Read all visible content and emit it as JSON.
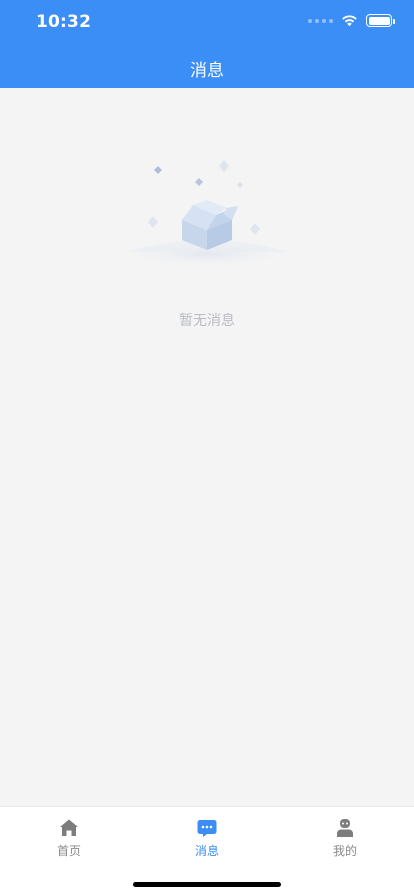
{
  "status_bar": {
    "time": "10:32",
    "icons": [
      "cellular-signal-icon",
      "wifi-icon",
      "battery-icon"
    ]
  },
  "nav": {
    "title": "消息"
  },
  "empty_state": {
    "illustration": "empty-box-icon",
    "text": "暂无消息"
  },
  "tabbar": {
    "tabs": [
      {
        "label": "首页",
        "icon": "home-icon",
        "active": false
      },
      {
        "label": "消息",
        "icon": "message-icon",
        "active": true
      },
      {
        "label": "我的",
        "icon": "profile-icon",
        "active": false
      }
    ]
  },
  "colors": {
    "primary": "#3a8ef6",
    "background": "#f4f4f4",
    "tab_inactive": "#8a8a8a",
    "empty_text": "#b9bcc2"
  }
}
